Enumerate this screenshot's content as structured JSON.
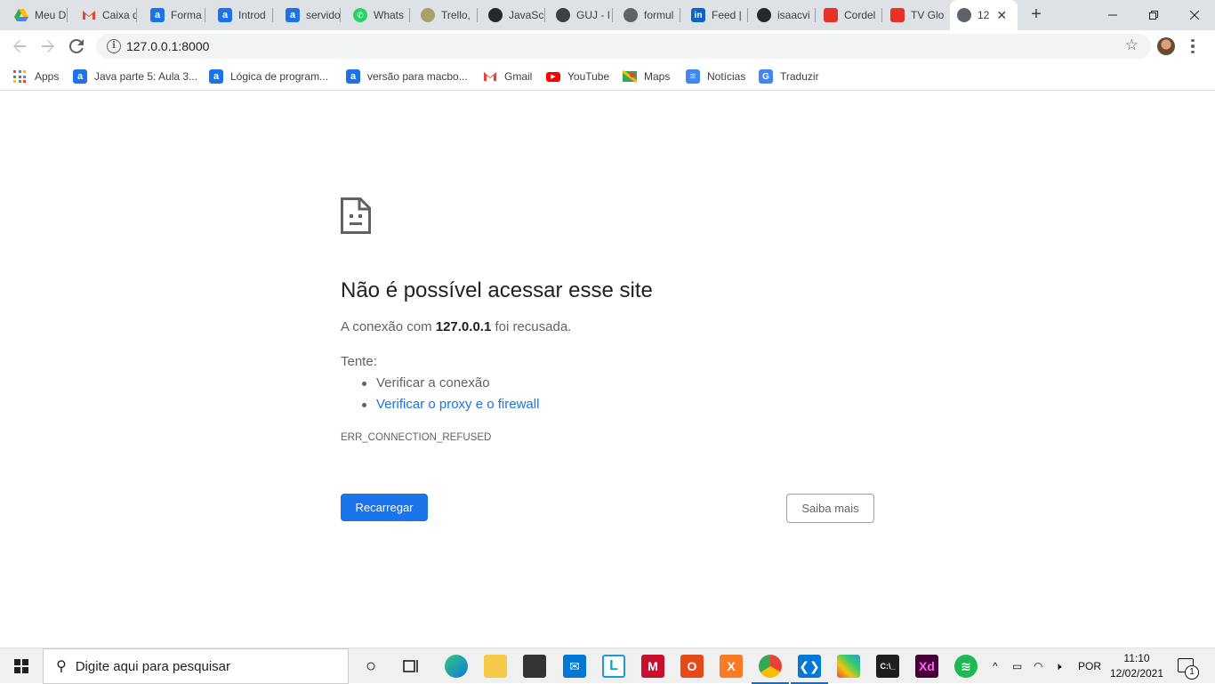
{
  "browser": {
    "tabs": [
      {
        "title": "Meu D",
        "icon": "google-drive-icon",
        "color": "#34a853"
      },
      {
        "title": "Caixa d",
        "icon": "gmail-icon",
        "color": "#ea4335"
      },
      {
        "title": "Forma",
        "icon": "alura-icon",
        "color": "#1a73e8"
      },
      {
        "title": "Introd",
        "icon": "alura-icon",
        "color": "#1a73e8"
      },
      {
        "title": "servido",
        "icon": "alura-icon",
        "color": "#1a73e8"
      },
      {
        "title": "Whats",
        "icon": "whatsapp-icon",
        "color": "#25d366"
      },
      {
        "title": "Trello,",
        "icon": "trello-icon",
        "color": "#a3a36a"
      },
      {
        "title": "JavaSc",
        "icon": "github-icon",
        "color": "#24292e"
      },
      {
        "title": "GUJ - I",
        "icon": "guj-icon",
        "color": "#3c4043"
      },
      {
        "title": "formul",
        "icon": "globe-icon",
        "color": "#5f6368"
      },
      {
        "title": "Feed |",
        "icon": "linkedin-icon",
        "color": "#0a66c2"
      },
      {
        "title": "isaacvi",
        "icon": "github-icon",
        "color": "#24292e"
      },
      {
        "title": "Cordel",
        "icon": "globoplay-icon",
        "color": "#e5332a"
      },
      {
        "title": "TV Glo",
        "icon": "globoplay-icon",
        "color": "#e5332a"
      },
      {
        "title": "12",
        "icon": "globe-icon",
        "color": "#5f6368",
        "active": true
      }
    ],
    "new_tab_label": "+",
    "address": "127.0.0.1:8000",
    "bookmarks": [
      {
        "label": "Apps",
        "icon": "apps-grid-icon"
      },
      {
        "label": "Java parte 5: Aula 3...",
        "icon": "alura-icon",
        "color": "#1a73e8"
      },
      {
        "label": "Lógica de program...",
        "icon": "alura-icon",
        "color": "#1a73e8"
      },
      {
        "label": "versão para macbo...",
        "icon": "alura-icon",
        "color": "#1a73e8"
      },
      {
        "label": "Gmail",
        "icon": "gmail-icon",
        "color": "#ea4335"
      },
      {
        "label": "YouTube",
        "icon": "youtube-icon",
        "color": "#ff0000"
      },
      {
        "label": "Maps",
        "icon": "maps-icon",
        "color": "#34a853"
      },
      {
        "label": "Notícias",
        "icon": "news-icon",
        "color": "#4285f4"
      },
      {
        "label": "Traduzir",
        "icon": "translate-icon",
        "color": "#4285f4"
      }
    ]
  },
  "error_page": {
    "title": "Não é possível acessar esse site",
    "desc_prefix": "A conexão com ",
    "desc_host": "127.0.0.1",
    "desc_suffix": " foi recusada.",
    "try_label": "Tente:",
    "suggestions": [
      "Verificar a conexão",
      "Verificar o proxy e o firewall"
    ],
    "error_code": "ERR_CONNECTION_REFUSED",
    "reload_button": "Recarregar",
    "more_button": "Saiba mais",
    "accent_color": "#1a73e8"
  },
  "taskbar": {
    "search_placeholder": "Digite aqui para pesquisar",
    "language": "POR",
    "time": "11:10",
    "date": "12/02/2021",
    "notification_count": "1"
  }
}
